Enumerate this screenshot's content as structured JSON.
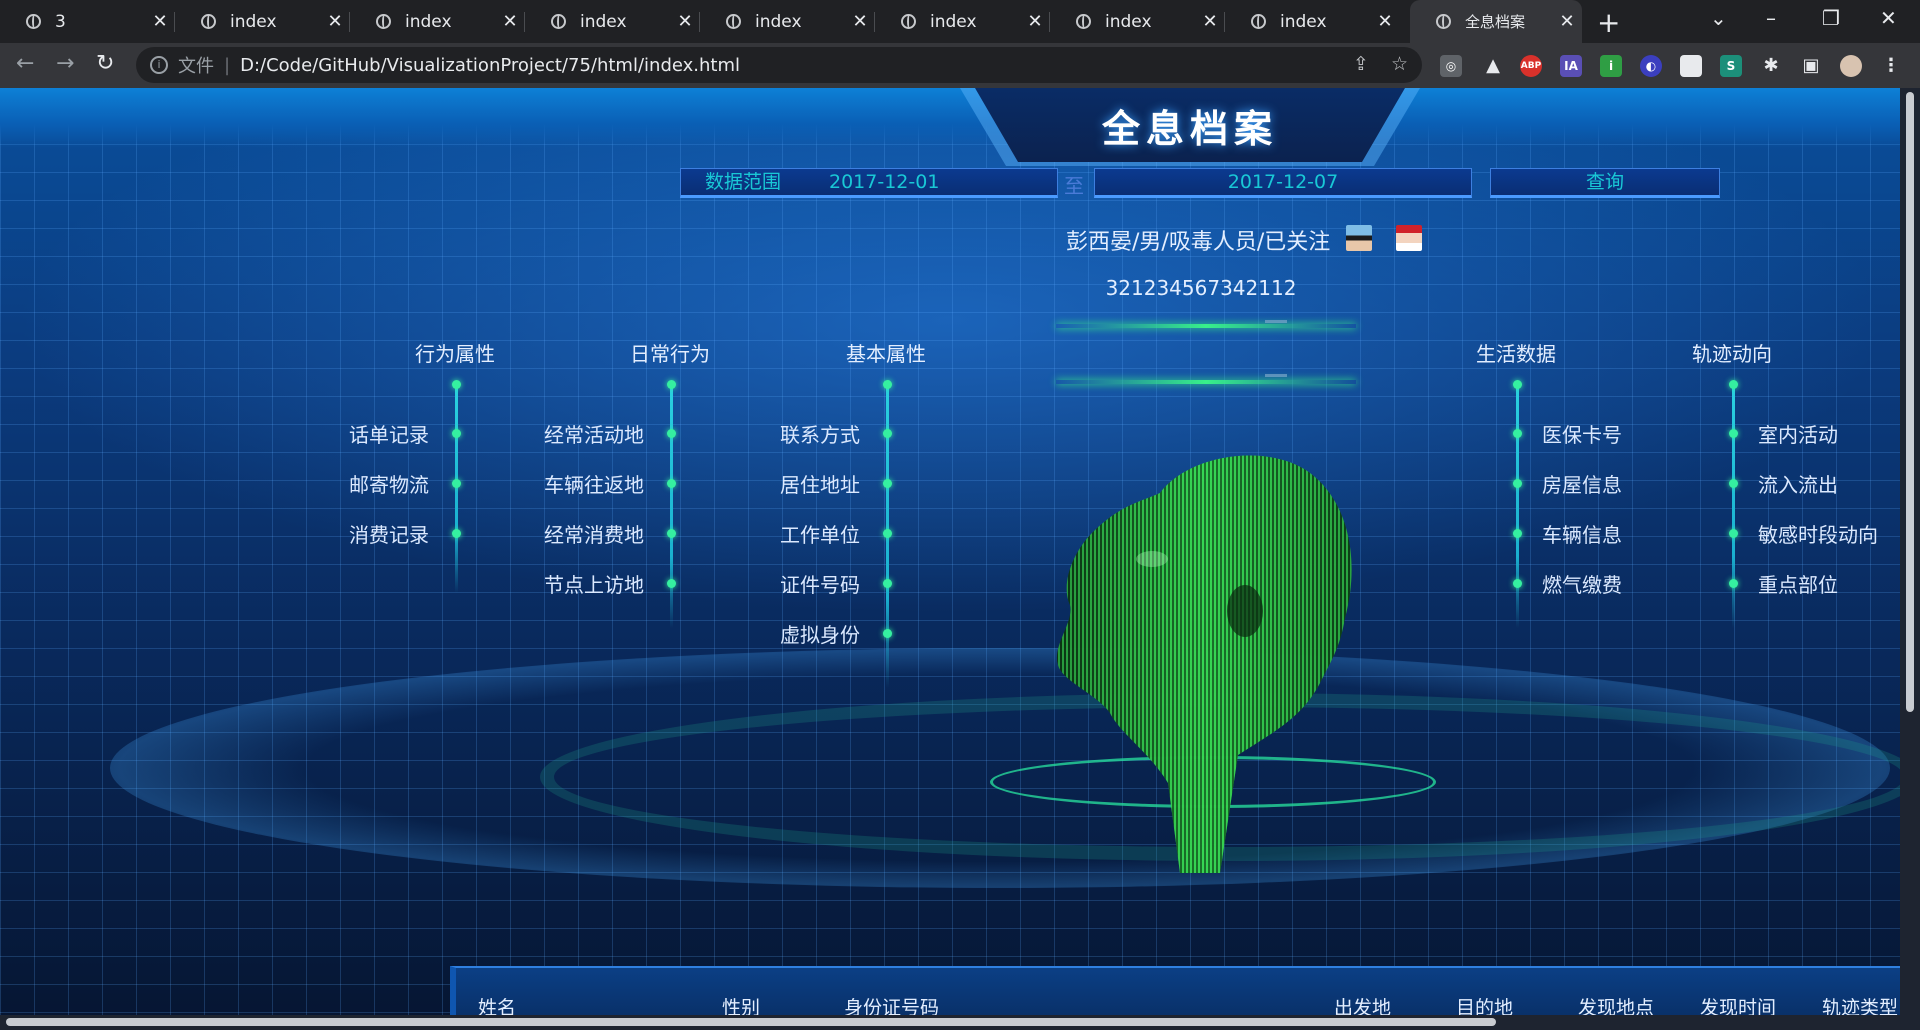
{
  "browser": {
    "tabs": [
      {
        "title": "3"
      },
      {
        "title": "index"
      },
      {
        "title": "index"
      },
      {
        "title": "index"
      },
      {
        "title": "index"
      },
      {
        "title": "index"
      },
      {
        "title": "index"
      },
      {
        "title": "index"
      },
      {
        "title": "全息档案",
        "active": true
      }
    ],
    "new_tab": "+",
    "omnibox": {
      "file_label": "文件",
      "separator": "|",
      "url": "D:/Code/GitHub/VisualizationProject/75/html/index.html"
    },
    "extensions": [
      "ABP",
      "IA"
    ]
  },
  "page": {
    "title": "全息档案",
    "query": {
      "range_label": "数据范围",
      "start_date": "2017-12-01",
      "to": "至",
      "end_date": "2017-12-07",
      "search_label": "查询"
    },
    "person": {
      "summary": "彭西晏/男/吸毒人员/已关注",
      "id_number": "321234567342112"
    },
    "categories": [
      {
        "name": "行为属性",
        "items": [
          "话单记录",
          "邮寄物流",
          "消费记录"
        ]
      },
      {
        "name": "日常行为",
        "items": [
          "经常活动地",
          "车辆往返地",
          "经常消费地",
          "节点上访地"
        ]
      },
      {
        "name": "基本属性",
        "items": [
          "联系方式",
          "居住地址",
          "工作单位",
          "证件号码",
          "虚拟身份"
        ]
      },
      {
        "name": "生活数据",
        "items": [
          "医保卡号",
          "房屋信息",
          "车辆信息",
          "燃气缴费"
        ]
      },
      {
        "name": "轨迹动向",
        "items": [
          "室内活动",
          "流入流出",
          "敏感时段动向",
          "重点部位"
        ]
      }
    ],
    "table_headers": [
      "姓名",
      "性别",
      "身份证号码",
      "出发地",
      "目的地",
      "发现地点",
      "发现时间",
      "轨迹类型"
    ]
  },
  "colors": {
    "accent_cyan": "#19c8d6",
    "glow_green": "#38f08a",
    "panel_blue": "#0b3a90"
  }
}
